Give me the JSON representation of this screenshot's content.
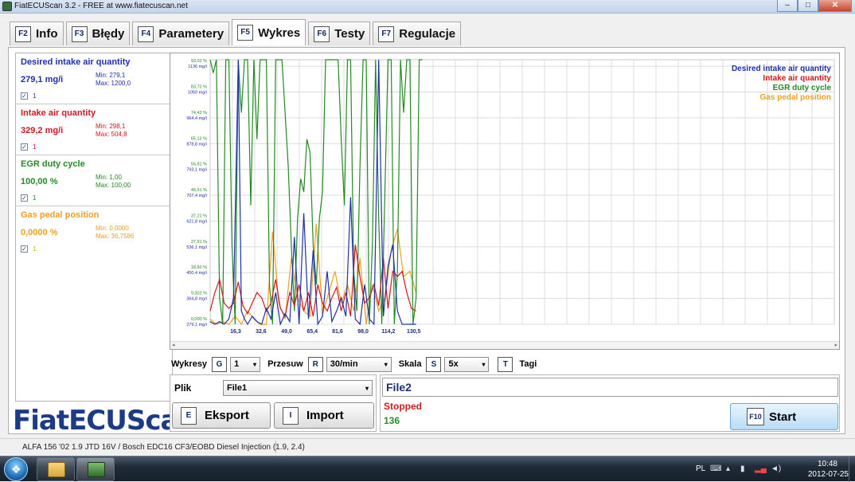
{
  "window": {
    "title": "FiatECUScan 3.2 - FREE at www.fiatecuscan.net",
    "controls": {
      "minimize": "–",
      "maximize": "□",
      "close": "✕"
    }
  },
  "tabs": [
    {
      "key": "F2",
      "label": "Info",
      "active": false
    },
    {
      "key": "F3",
      "label": "Błędy",
      "active": false
    },
    {
      "key": "F4",
      "label": "Parametery",
      "active": false
    },
    {
      "key": "F5",
      "label": "Wykres",
      "active": true
    },
    {
      "key": "F6",
      "label": "Testy",
      "active": false
    },
    {
      "key": "F7",
      "label": "Regulacje",
      "active": false
    }
  ],
  "params": [
    {
      "name": "Desired intake air quantity",
      "value": "279,1 mg/i",
      "min": "Min: 279,1",
      "max": "Max: 1200,0",
      "checked": "✓",
      "num": "1",
      "color": "#1e2fb0"
    },
    {
      "name": "Intake air quantity",
      "value": "329,2 mg/i",
      "min": "Min: 298,1",
      "max": "Max: 504,8",
      "checked": "✓",
      "num": "1",
      "color": "#d3171d"
    },
    {
      "name": "EGR duty cycle",
      "value": "100,00 %",
      "min": "Min: 1,00",
      "max": "Max: 100,00",
      "checked": "✓",
      "num": "1",
      "color": "#228b22"
    },
    {
      "name": "Gas pedal position",
      "value": "0,0000 %",
      "min": "Min: 0,0000",
      "max": "Max: 36,7586",
      "checked": "✓",
      "num": "1",
      "color": "#f0a020"
    }
  ],
  "logo": "FiatECUScan",
  "chart_data": {
    "type": "line",
    "x_ticks": [
      "16,3",
      "32,6",
      "49,0",
      "65,4",
      "81,6",
      "98,0",
      "114,2",
      "130,5"
    ],
    "x_tick_values": [
      16.3,
      32.6,
      49.0,
      65.4,
      81.6,
      98.0,
      114.2,
      130.5
    ],
    "xlim": [
      0,
      400
    ],
    "y_tick_pct": [
      "0,000 %",
      "9,302 %",
      "18,60 %",
      "27,91 %",
      "37,21 %",
      "46,51 %",
      "55,81 %",
      "65,12 %",
      "74,42 %",
      "83,72 %",
      "93,02 %"
    ],
    "y_tick_mg": [
      "279,1 mg/i",
      "364,8 mg/i",
      "450,4 mg/i",
      "536,1 mg/i",
      "621,8 mg/i",
      "707,4 mg/i",
      "793,1 mg/i",
      "878,8 mg/i",
      "964,4 mg/i",
      "1050 mg/i",
      "1136 mg/i"
    ],
    "ylim": [
      0,
      100
    ],
    "grid": true,
    "legend_position": "top-right",
    "series": [
      {
        "name": "Desired intake air quantity",
        "color": "#1e2fb0",
        "x": [
          0,
          3,
          6,
          9,
          12,
          15,
          18,
          20,
          22,
          24,
          27,
          30,
          33,
          36,
          39,
          42,
          45,
          48,
          51,
          54,
          57,
          60,
          63,
          66,
          69,
          72,
          75,
          78,
          81,
          84,
          87,
          90,
          93,
          96,
          99,
          102,
          105,
          108,
          111,
          114,
          117,
          120,
          123,
          126,
          129,
          132
        ],
        "y": [
          1,
          0,
          1,
          0,
          2,
          10,
          100,
          5,
          2,
          0,
          3,
          1,
          0,
          6,
          2,
          12,
          0,
          4,
          1,
          33,
          0,
          42,
          2,
          28,
          0,
          3,
          20,
          1,
          5,
          10,
          3,
          48,
          2,
          0,
          15,
          2,
          0,
          100,
          3,
          22,
          30,
          5,
          0,
          0,
          0,
          0
        ]
      },
      {
        "name": "Intake air quantity",
        "color": "#d3171d",
        "x": [
          0,
          3,
          6,
          9,
          12,
          15,
          18,
          21,
          24,
          27,
          30,
          33,
          36,
          39,
          42,
          45,
          48,
          51,
          54,
          57,
          60,
          63,
          66,
          69,
          72,
          75,
          78,
          81,
          84,
          87,
          90,
          93,
          96,
          99,
          102,
          105,
          108,
          111,
          114,
          117,
          120,
          123,
          126,
          129,
          132
        ],
        "y": [
          5,
          12,
          17,
          8,
          6,
          8,
          16,
          7,
          4,
          8,
          12,
          10,
          5,
          8,
          17,
          6,
          3,
          12,
          7,
          15,
          5,
          12,
          3,
          15,
          8,
          5,
          10,
          14,
          5,
          12,
          3,
          30,
          18,
          8,
          10,
          15,
          7,
          25,
          6,
          20,
          18,
          20,
          12,
          6,
          5
        ]
      },
      {
        "name": "EGR duty cycle",
        "color": "#228b22",
        "x": [
          0,
          2,
          4,
          6,
          8,
          10,
          12,
          14,
          16,
          18,
          20,
          22,
          24,
          26,
          28,
          30,
          32,
          34,
          36,
          38,
          40,
          42,
          44,
          46,
          48,
          50,
          52,
          54,
          56,
          58,
          60,
          62,
          64,
          66,
          68,
          70,
          72,
          74,
          76,
          78,
          80,
          82,
          84,
          86,
          88,
          90,
          92,
          94,
          96,
          98,
          100,
          102,
          104,
          106,
          108,
          110,
          112,
          114,
          116,
          118,
          120,
          122,
          124,
          126,
          128,
          130,
          132,
          134,
          136
        ],
        "y": [
          100,
          95,
          100,
          10,
          0,
          100,
          100,
          30,
          0,
          100,
          80,
          100,
          100,
          45,
          100,
          70,
          100,
          100,
          100,
          15,
          0,
          100,
          100,
          100,
          80,
          60,
          30,
          5,
          40,
          55,
          50,
          70,
          65,
          30,
          15,
          40,
          50,
          100,
          100,
          100,
          100,
          100,
          70,
          45,
          100,
          100,
          20,
          5,
          60,
          100,
          100,
          0,
          30,
          100,
          40,
          0,
          50,
          100,
          100,
          0,
          20,
          100,
          80,
          100,
          100,
          0,
          10,
          100,
          100
        ]
      },
      {
        "name": "Gas pedal position",
        "color": "#f0a020",
        "x": [
          0,
          4,
          8,
          12,
          16,
          20,
          24,
          28,
          32,
          36,
          40,
          44,
          48,
          52,
          56,
          60,
          64,
          68,
          72,
          76,
          80,
          84,
          88,
          92,
          96,
          100,
          104,
          108,
          112,
          116,
          120,
          124,
          128,
          132
        ],
        "y": [
          2,
          0,
          1,
          0,
          3,
          0,
          5,
          2,
          0,
          0,
          35,
          8,
          2,
          25,
          10,
          5,
          3,
          38,
          4,
          12,
          20,
          8,
          15,
          5,
          25,
          0,
          15,
          5,
          10,
          28,
          36,
          18,
          20,
          12
        ]
      }
    ]
  },
  "controls": {
    "wykresy_label": "Wykresy",
    "wykresy_key": "G",
    "wykresy_value": "1",
    "przesuw_label": "Przesuw",
    "przesuw_key": "R",
    "przesuw_value": "30/min",
    "skala_label": "Skala",
    "skala_key": "S",
    "skala_value": "5x",
    "tagi_key": "T",
    "tagi_label": "Tagi",
    "dropdown_arrow": "▾"
  },
  "file": {
    "label": "Plik",
    "value": "File1",
    "export_key": "E",
    "export_label": "Eksport",
    "import_key": "I",
    "import_label": "Import"
  },
  "status": {
    "filename": "File2",
    "state": "Stopped",
    "count": "136",
    "start_key": "F10",
    "start_label": "Start"
  },
  "statusbar": {
    "text": "ALFA 156 '02 1.9 JTD 16V / Bosch EDC16 CF3/EOBD Diesel Injection (1.9, 2.4)"
  },
  "taskbar": {
    "lang": "PL",
    "time": "10:48",
    "date": "2012-07-25",
    "start_glyph": "❖",
    "tray_icons": {
      "keyboard": "⌨",
      "arrow": "▴",
      "battery": "▮",
      "volume": "◄)"
    }
  }
}
